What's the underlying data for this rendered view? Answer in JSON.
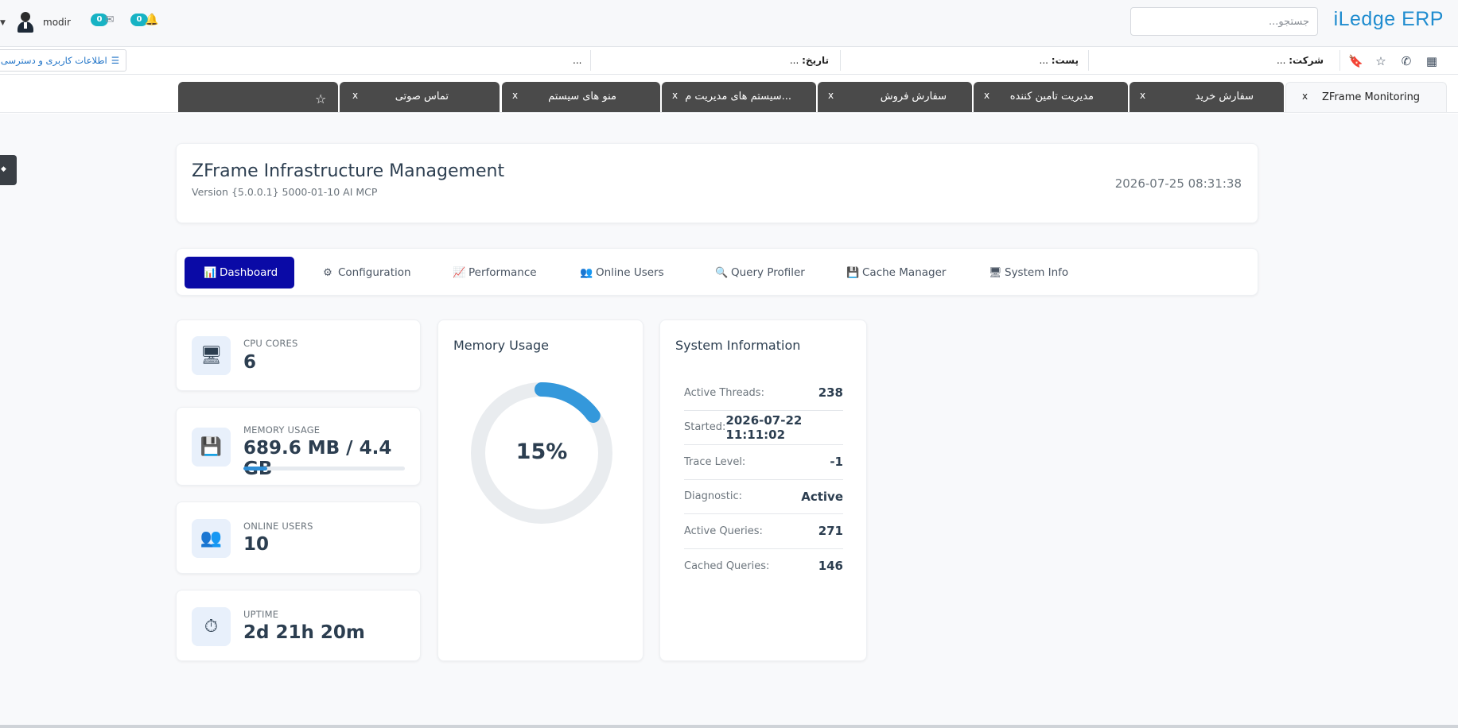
{
  "header": {
    "logo": "iLedge ERP",
    "search_placeholder": "جستجو...",
    "user_name": "modir",
    "messages_count": "0",
    "notifications_count": "0"
  },
  "infobar": {
    "company_label": "شرکت:",
    "company_value": "...",
    "post_label": "پست:",
    "post_value": "...",
    "date_label": "تاریخ:",
    "date_value": "...",
    "extra_value": "...",
    "access_button": "اطلاعات کاربری و دسترسی"
  },
  "tabs": [
    {
      "label": "ZFrame Monitoring",
      "close": "x"
    },
    {
      "label": "سفارش خرید",
      "close": "x"
    },
    {
      "label": "مدیریت تامین کننده",
      "close": "x"
    },
    {
      "label": "سفارش فروش",
      "close": "x"
    },
    {
      "label": "سیستم های مدیریت م...",
      "close": "x"
    },
    {
      "label": "منو های سیستم",
      "close": "x"
    },
    {
      "label": "تماس صوتی",
      "close": "x"
    }
  ],
  "page": {
    "title": "ZFrame Infrastructure Management",
    "version": "Version {5.0.0.1} 5000-01-10 AI MCP",
    "datetime": "2026-07-25 08:31:38"
  },
  "nav": [
    {
      "label": "Dashboard",
      "icon": "chart-icon"
    },
    {
      "label": "Configuration",
      "icon": "gear-icon"
    },
    {
      "label": "Performance",
      "icon": "line-chart-icon"
    },
    {
      "label": "Online Users",
      "icon": "users-icon"
    },
    {
      "label": "Query Profiler",
      "icon": "magnifier-icon"
    },
    {
      "label": "Cache Manager",
      "icon": "floppy-icon"
    },
    {
      "label": "System Info",
      "icon": "monitor-icon"
    }
  ],
  "stats": {
    "cpu": {
      "label": "CPU CORES",
      "value": "6"
    },
    "memory": {
      "label": "MEMORY USAGE",
      "value": "689.6 MB / 4.4 GB",
      "progress": 0.15
    },
    "users": {
      "label": "ONLINE USERS",
      "value": "10"
    },
    "uptime": {
      "label": "UPTIME",
      "value": "2d 21h 20m"
    }
  },
  "memory_card": {
    "title": "Memory Usage",
    "percent_text": "15%",
    "percent": 0.15,
    "track_color": "#e9ecef",
    "fill_color": "#3498db"
  },
  "system_info": {
    "title": "System Information",
    "rows": [
      {
        "key": "Active Threads:",
        "value": "238"
      },
      {
        "key": "Started:",
        "value": "2026-07-22 11:11:02"
      },
      {
        "key": "Trace Level:",
        "value": "-1"
      },
      {
        "key": "Diagnostic:",
        "value": "Active"
      },
      {
        "key": "Active Queries:",
        "value": "271"
      },
      {
        "key": "Cached Queries:",
        "value": "146"
      }
    ]
  }
}
